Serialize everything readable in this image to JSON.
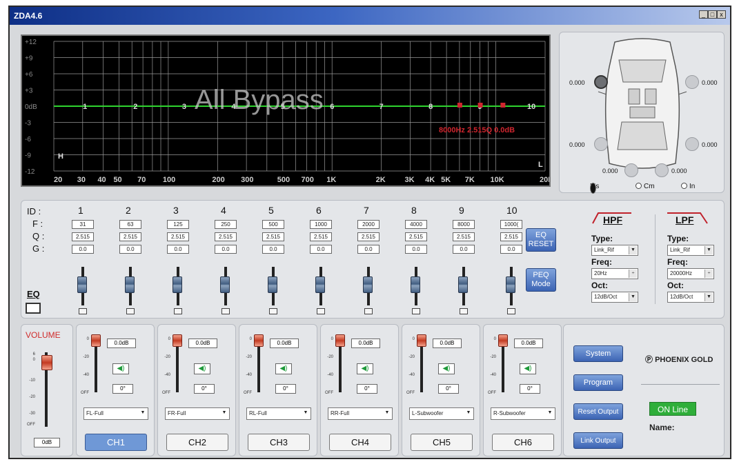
{
  "window": {
    "title": "ZDA4.6",
    "buttons": [
      "_",
      "□",
      "x"
    ]
  },
  "graph": {
    "overlay_text": "All Bypass",
    "y_labels": [
      "+12",
      "+9",
      "+6",
      "+3",
      "0dB",
      "-3",
      "-6",
      "-9",
      "-12"
    ],
    "x_labels": [
      "20",
      "30",
      "40",
      "50",
      "70",
      "100",
      "200",
      "300",
      "500",
      "700",
      "1K",
      "2K",
      "3K",
      "4K",
      "5K",
      "7K",
      "10K",
      "20K"
    ],
    "band_markers": [
      "1",
      "2",
      "3",
      "4",
      "5",
      "6",
      "7",
      "8",
      "9",
      "10"
    ],
    "readout": "8000Hz 2.515Q 0.0dB",
    "h_marker": "H",
    "l_marker": "L",
    "colors": {
      "flat_line": "#2fd52f",
      "readout": "#d0262f",
      "grid": "#9a9a9a"
    }
  },
  "car": {
    "values": {
      "fl": "0.000",
      "fr": "0.000",
      "rl": "0.000",
      "rr": "0.000",
      "sl": "0.000",
      "sr": "0.000"
    },
    "units": [
      {
        "label": "Ms",
        "selected": true
      },
      {
        "label": "Cm",
        "selected": false
      },
      {
        "label": "In",
        "selected": false
      }
    ]
  },
  "eq": {
    "row_labels": [
      "ID :",
      "F :",
      "Q :",
      "G :"
    ],
    "bands": [
      {
        "id": "1",
        "f": "31",
        "q": "2.515",
        "g": "0.0"
      },
      {
        "id": "2",
        "f": "63",
        "q": "2.515",
        "g": "0.0"
      },
      {
        "id": "3",
        "f": "125",
        "q": "2.515",
        "g": "0.0"
      },
      {
        "id": "4",
        "f": "250",
        "q": "2.515",
        "g": "0.0"
      },
      {
        "id": "5",
        "f": "500",
        "q": "2.515",
        "g": "0.0"
      },
      {
        "id": "6",
        "f": "1000",
        "q": "2.515",
        "g": "0.0"
      },
      {
        "id": "7",
        "f": "2000",
        "q": "2.515",
        "g": "0.0"
      },
      {
        "id": "8",
        "f": "4000",
        "q": "2.515",
        "g": "0.0"
      },
      {
        "id": "9",
        "f": "8000",
        "q": "2.515",
        "g": "0.0"
      },
      {
        "id": "10",
        "f": "1000(",
        "q": "2.515",
        "g": "0.0"
      }
    ],
    "eq_label": "EQ",
    "eq_reset": [
      "EQ",
      "RESET"
    ],
    "peq_mode": [
      "PEQ",
      "Mode"
    ],
    "hpf": {
      "title": "HPF",
      "type_label": "Type:",
      "type_value": "Link_Rif",
      "freq_label": "Freq:",
      "freq_value": "20Hz",
      "oct_label": "Oct:",
      "oct_value": "12dB/Oct"
    },
    "lpf": {
      "title": "LPF",
      "type_label": "Type:",
      "type_value": "Link_Rif",
      "freq_label": "Freq:",
      "freq_value": "20000Hz",
      "oct_label": "Oct:",
      "oct_value": "12dB/Oct"
    }
  },
  "volume": {
    "label": "VOLUME",
    "scale": [
      "0",
      "-10",
      "-20",
      "-30",
      "OFF"
    ],
    "top_scale": "6",
    "value": "0dB"
  },
  "channels": [
    {
      "name": "CH1",
      "level": "0.0dB",
      "phase": "0°",
      "assign": "FL-Full",
      "active": true
    },
    {
      "name": "CH2",
      "level": "0.0dB",
      "phase": "0°",
      "assign": "FR-Full",
      "active": false
    },
    {
      "name": "CH3",
      "level": "0.0dB",
      "phase": "0°",
      "assign": "RL-Full",
      "active": false
    },
    {
      "name": "CH4",
      "level": "0.0dB",
      "phase": "0°",
      "assign": "RR-Full",
      "active": false
    },
    {
      "name": "CH5",
      "level": "0.0dB",
      "phase": "0°",
      "assign": "L-Subwoofer",
      "active": false
    },
    {
      "name": "CH6",
      "level": "0.0dB",
      "phase": "0°",
      "assign": "R-Subwoofer",
      "active": false
    }
  ],
  "channel_scale": [
    "0",
    "-20",
    "-40",
    "OFF"
  ],
  "system": {
    "buttons": [
      "System",
      "Program",
      "Reset Output",
      "Link Output"
    ],
    "brand": "PHOENIX GOLD",
    "status": "ON Line",
    "name_label": "Name:",
    "status_color": "#2fae3a"
  }
}
